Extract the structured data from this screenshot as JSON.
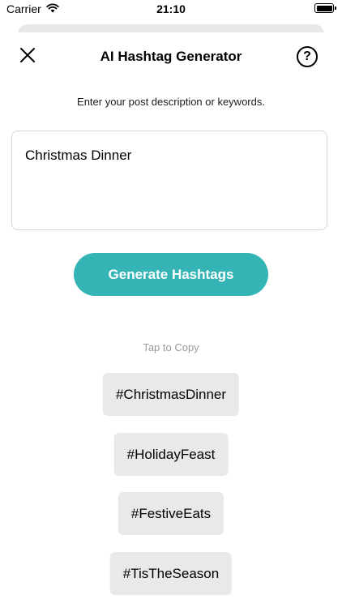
{
  "status_bar": {
    "carrier": "Carrier",
    "time": "21:10",
    "wifi_icon": "wifi-icon",
    "battery_icon": "battery-icon"
  },
  "nav": {
    "title": "AI Hashtag Generator",
    "close_icon": "close-icon",
    "help_label": "?"
  },
  "instruction": "Enter your post description or keywords.",
  "input": {
    "value": "Christmas Dinner"
  },
  "generate_label": "Generate Hashtags",
  "tap_hint": "Tap to Copy",
  "hashtags": [
    "#ChristmasDinner",
    "#HolidayFeast",
    "#FestiveEats",
    "#TisTheSeason"
  ],
  "colors": {
    "accent": "#35b4b6",
    "tag_bg": "#e9e9eb",
    "hint_text": "#9a9a9e"
  }
}
